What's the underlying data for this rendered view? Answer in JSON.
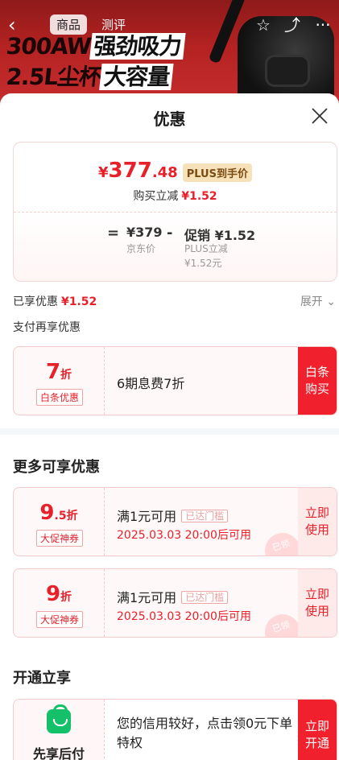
{
  "banner": {
    "tabs": [
      "商品",
      "测评"
    ],
    "promo_line1_a": "300AW",
    "promo_line1_b": "强劲吸力",
    "promo_line2_a": "2.5L尘杯",
    "promo_line2_b": "大容量"
  },
  "sheet": {
    "title": "优惠"
  },
  "price_card": {
    "price_symbol": "¥",
    "price_int": "377",
    "price_dec": ".48",
    "plus_tag": "PLUS到手价",
    "reduce_label": "购买立减",
    "reduce_value": "¥1.52",
    "equals": "=",
    "jd_price": "¥379",
    "jd_price_label": "京东价",
    "minus": "-",
    "promo_value": "促销 ¥1.52",
    "promo_sub1": "PLUS立减",
    "promo_sub2": "¥1.52元"
  },
  "enjoyed": {
    "label": "已享优惠",
    "value": "¥1.52",
    "expand": "展开"
  },
  "pay_more": "支付再享优惠",
  "baitiao": {
    "disc_big": "7",
    "disc_small": "折",
    "tag": "白条优惠",
    "title": "6期息费7折",
    "action_l1": "白条",
    "action_l2": "购买"
  },
  "more_section": "更多可享优惠",
  "coupons": [
    {
      "disc_big": "9",
      "disc_small": ".5折",
      "tag": "大促神券",
      "title": "满1元可用",
      "chip": "已达门槛",
      "time": "2025.03.03 20:00后可用",
      "action_l1": "立即",
      "action_l2": "使用",
      "stamp": "已领"
    },
    {
      "disc_big": "9",
      "disc_small": "折",
      "tag": "大促神券",
      "title": "满1元可用",
      "chip": "已达门槛",
      "time": "2025.03.03 20:00后可用",
      "action_l1": "立即",
      "action_l2": "使用",
      "stamp": "已领"
    }
  ],
  "open_section": "开通立享",
  "credit": {
    "name": "先享后付",
    "desc": "您的信用较好，点击领0元下单特权",
    "action_l1": "立即",
    "action_l2": "开通"
  },
  "colors": {
    "accent": "#e8202a",
    "action_red": "#f0202c",
    "plus_gold": "#f7e1b8",
    "green_bag": "#14c06a"
  }
}
